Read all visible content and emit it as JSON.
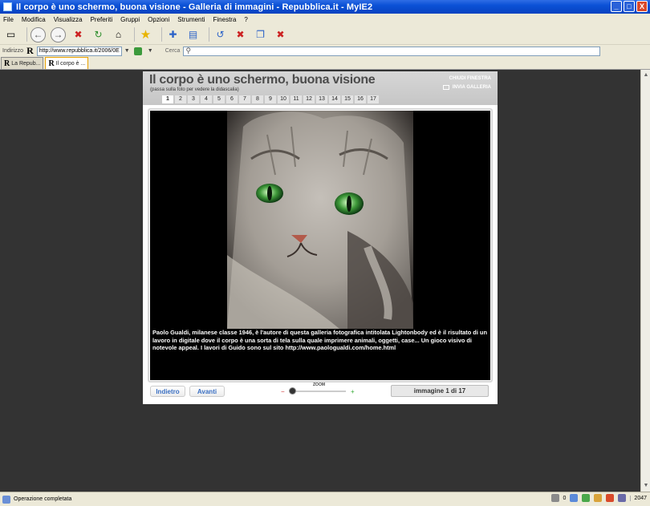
{
  "window": {
    "title": "Il corpo è uno schermo, buona visione - Galleria di immagini - Repubblica.it - MyIE2",
    "buttons": [
      "_",
      "□",
      "X"
    ]
  },
  "menu": [
    "File",
    "Modifica",
    "Visualizza",
    "Preferiti",
    "Gruppi",
    "Opzioni",
    "Strumenti",
    "Finestra",
    "?"
  ],
  "addressbar": {
    "label": "Indirizzo",
    "url": "http://www.repubblica.it/2006/0E",
    "search_label": "Cerca"
  },
  "tabs": [
    {
      "label": "La Repub...",
      "active": false
    },
    {
      "label": "Il corpo è ...",
      "active": true
    }
  ],
  "gallery": {
    "title": "Il corpo è uno schermo, buona visione",
    "hint": "(passa sulla foto per vedere la didascalia)",
    "close_label": "CHIUDI FINESTRA",
    "send_label": "INVIA GALLERIA",
    "pages": [
      "1",
      "2",
      "3",
      "4",
      "5",
      "6",
      "7",
      "8",
      "9",
      "10",
      "11",
      "12",
      "13",
      "14",
      "15",
      "16",
      "17"
    ],
    "current_page": "1",
    "caption": "Paolo Gualdi, milanese classe 1946, è l'autore di questa galleria fotografica intitolata Lightonbody ed è il risultato di un lavoro in digitale dove il corpo è una sorta di tela sulla quale imprimere animali, oggetti, case... Un gioco visivo di notevole appeal. I lavori di Guido sono sul sito http://www.paologualdi.com/home.html",
    "back_label": "Indietro",
    "forward_label": "Avanti",
    "zoom_label": "ZOOM",
    "counter": "immagine 1 di 17"
  },
  "status": {
    "text": "Operazione completata",
    "count": "0",
    "size": "2047"
  }
}
